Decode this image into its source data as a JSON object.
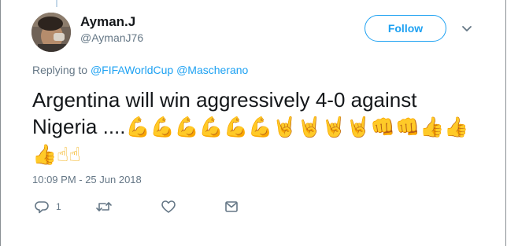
{
  "tweet": {
    "author": {
      "display_name": "Ayman.J",
      "handle": "@AymanJ76"
    },
    "follow_label": "Follow",
    "replying_prefix": "Replying to",
    "reply_mentions": [
      "@FIFAWorldCup",
      "@Mascherano"
    ],
    "text": "Argentina will win aggressively 4-0 against Nigeria ....",
    "emojis": [
      "💪",
      "💪",
      "💪",
      "💪",
      "💪",
      "💪",
      "🤘",
      "🤘",
      "🤘",
      "🤘",
      "👊",
      "👊",
      "👍",
      "👍",
      "👍",
      "☝",
      "☝"
    ],
    "timestamp": "10:09 PM - 25 Jun 2018",
    "reply_count": "1"
  },
  "colors": {
    "accent": "#1da1f2",
    "secondary_text": "#657786",
    "primary_text": "#14171a"
  },
  "icons": [
    "caret-down-icon",
    "reply-icon",
    "retweet-icon",
    "like-icon",
    "direct-message-icon"
  ]
}
